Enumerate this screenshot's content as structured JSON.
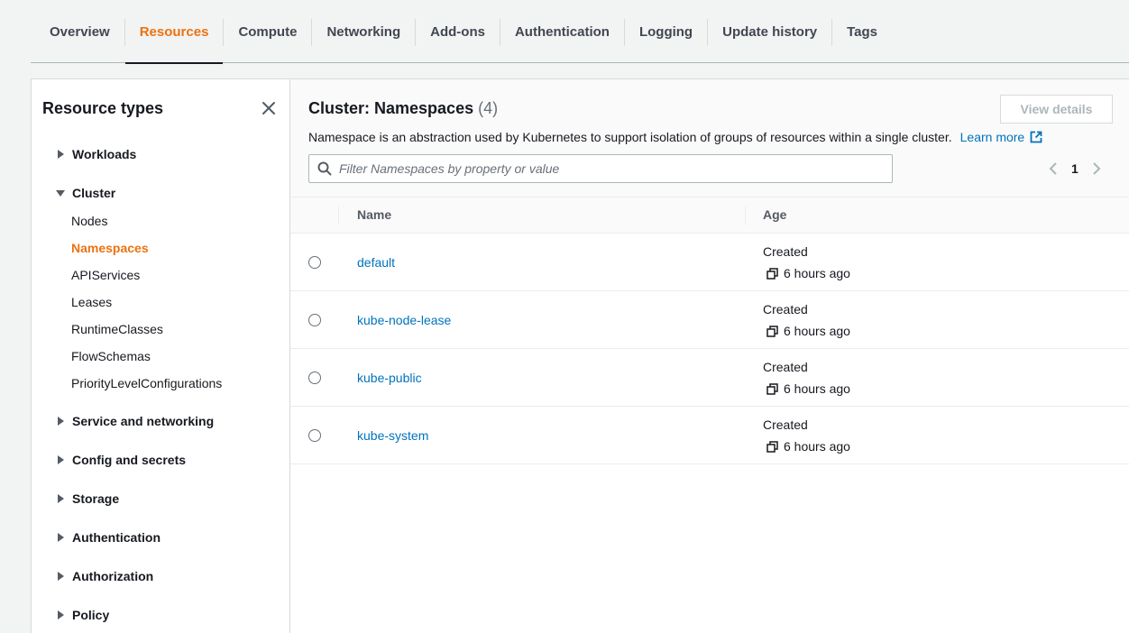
{
  "tabs": [
    {
      "label": "Overview",
      "active": false
    },
    {
      "label": "Resources",
      "active": true
    },
    {
      "label": "Compute",
      "active": false
    },
    {
      "label": "Networking",
      "active": false
    },
    {
      "label": "Add-ons",
      "active": false
    },
    {
      "label": "Authentication",
      "active": false
    },
    {
      "label": "Logging",
      "active": false
    },
    {
      "label": "Update history",
      "active": false
    },
    {
      "label": "Tags",
      "active": false
    }
  ],
  "sidebar": {
    "title": "Resource types",
    "close_icon": "close-icon",
    "groups": {
      "workloads": "Workloads",
      "cluster": "Cluster",
      "service_networking": "Service and networking",
      "config_secrets": "Config and secrets",
      "storage": "Storage",
      "authentication": "Authentication",
      "authorization": "Authorization",
      "policy": "Policy"
    },
    "cluster_items": [
      "Nodes",
      "Namespaces",
      "APIServices",
      "Leases",
      "RuntimeClasses",
      "FlowSchemas",
      "PriorityLevelConfigurations"
    ],
    "active_item": "Namespaces"
  },
  "main": {
    "title": "Cluster: Namespaces",
    "count": "(4)",
    "view_details": "View details",
    "description": "Namespace is an abstraction used by Kubernetes to support isolation of groups of resources within a single cluster.",
    "learn_more": "Learn more",
    "filter_placeholder": "Filter Namespaces by property or value",
    "page": "1",
    "columns": {
      "name": "Name",
      "age": "Age"
    },
    "rows": [
      {
        "name": "default",
        "created": "Created",
        "age": "6 hours ago"
      },
      {
        "name": "kube-node-lease",
        "created": "Created",
        "age": "6 hours ago"
      },
      {
        "name": "kube-public",
        "created": "Created",
        "age": "6 hours ago"
      },
      {
        "name": "kube-system",
        "created": "Created",
        "age": "6 hours ago"
      }
    ]
  },
  "colors": {
    "accent": "#ec7211",
    "link": "#0073bb",
    "text": "#16191f"
  }
}
